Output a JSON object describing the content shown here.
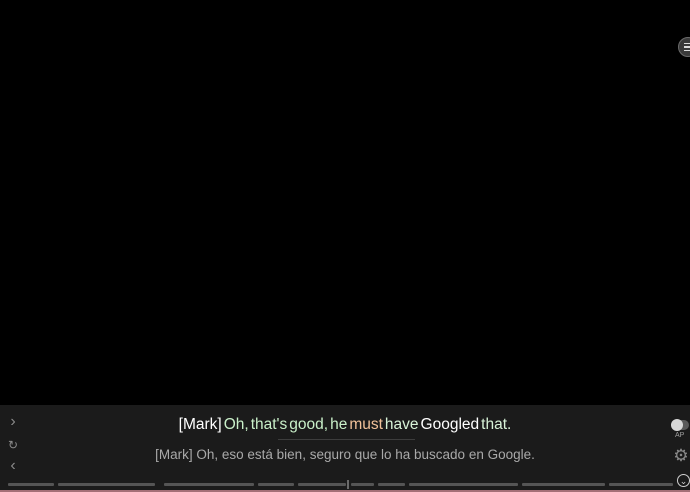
{
  "player": {
    "menu_icon": "hamburger-menu-icon"
  },
  "subtitles": {
    "primary": {
      "words": [
        {
          "text": "[Mark]",
          "color": "#ffffff"
        },
        {
          "text": "Oh,",
          "color": "#c9f0c9"
        },
        {
          "text": "that's",
          "color": "#c9f0c9"
        },
        {
          "text": "good,",
          "color": "#c9f0c9"
        },
        {
          "text": "he",
          "color": "#c9f0c9"
        },
        {
          "text": "must",
          "color": "#f2c29a"
        },
        {
          "text": "have",
          "color": "#d8f3d8"
        },
        {
          "text": "Googled",
          "color": "#ffffff"
        },
        {
          "text": "that.",
          "color": "#d8f3d8"
        }
      ]
    },
    "translation": "[Mark] Oh, eso está bien, seguro que lo ha buscado en Google."
  },
  "controls": {
    "next_icon": "chevron-right-icon",
    "repeat_icon": "repeat-icon",
    "prev_icon": "chevron-left-icon",
    "auto_pause_label": "AP",
    "auto_pause_on": false,
    "settings_icon": "gear-icon",
    "collapse_icon": "chevron-down-circle-icon"
  },
  "colors": {
    "background": "#000000",
    "panel": "#1b1b1b",
    "accent_bottom": "#a46f77"
  }
}
